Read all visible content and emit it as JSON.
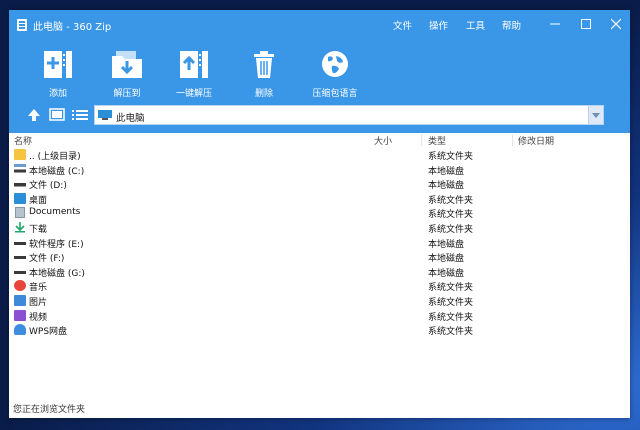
{
  "window": {
    "title": "此电脑 - 360 Zip"
  },
  "menu": [
    "文件",
    "操作",
    "工具",
    "帮助"
  ],
  "toolbar": [
    {
      "label": "添加",
      "icon": "add-archive-icon"
    },
    {
      "label": "解压到",
      "icon": "extract-to-icon"
    },
    {
      "label": "一键解压",
      "icon": "quick-extract-icon"
    },
    {
      "label": "删除",
      "icon": "trash-icon"
    },
    {
      "label": "压缩包语言",
      "icon": "globe-icon"
    }
  ],
  "address": {
    "path": "此电脑"
  },
  "columns": [
    "名称",
    "大小",
    "类型",
    "修改日期"
  ],
  "rows": [
    {
      "name": ".. (上级目录)",
      "type": "系统文件夹",
      "icon": "folder-up-icon"
    },
    {
      "name": "本地磁盘 (C:)",
      "type": "本地磁盘",
      "icon": "system-drive-icon"
    },
    {
      "name": "文件 (D:)",
      "type": "本地磁盘",
      "icon": "drive-icon"
    },
    {
      "name": "桌面",
      "type": "系统文件夹",
      "icon": "desktop-icon"
    },
    {
      "name": "Documents",
      "type": "系统文件夹",
      "icon": "documents-icon"
    },
    {
      "name": "下载",
      "type": "系统文件夹",
      "icon": "download-icon"
    },
    {
      "name": "软件程序 (E:)",
      "type": "本地磁盘",
      "icon": "drive-icon"
    },
    {
      "name": "文件 (F:)",
      "type": "本地磁盘",
      "icon": "drive-icon"
    },
    {
      "name": "本地磁盘 (G:)",
      "type": "本地磁盘",
      "icon": "drive-icon"
    },
    {
      "name": "音乐",
      "type": "系统文件夹",
      "icon": "music-icon"
    },
    {
      "name": "图片",
      "type": "系统文件夹",
      "icon": "pictures-icon"
    },
    {
      "name": "视频",
      "type": "系统文件夹",
      "icon": "video-icon"
    },
    {
      "name": "WPS网盘",
      "type": "系统文件夹",
      "icon": "cloud-icon"
    }
  ],
  "status": "您正在浏览文件夹",
  "colors": {
    "accent": "#3a97e8",
    "background": "#ffffff"
  }
}
